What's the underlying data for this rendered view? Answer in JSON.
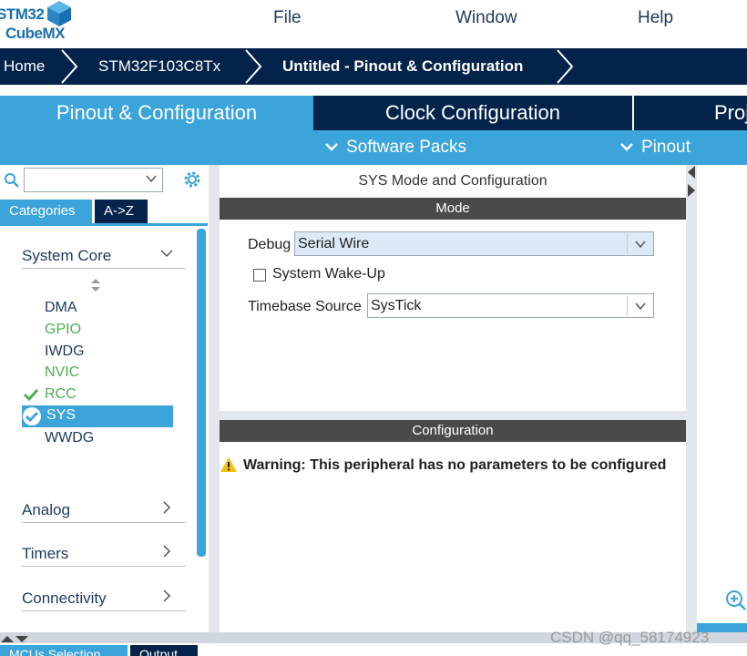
{
  "app": {
    "logo_line1": "STM32",
    "logo_line2": "CubeMX",
    "menu": [
      "File",
      "Window",
      "Help"
    ]
  },
  "breadcrumb": [
    "Home",
    "STM32F103C8Tx",
    "Untitled - Pinout & Configuration"
  ],
  "tabs": {
    "pinout_config": "Pinout & Configuration",
    "clock_config": "Clock Configuration",
    "project_partial": "Proj"
  },
  "subbar": {
    "software_packs": "Software Packs",
    "pinout": "Pinout"
  },
  "left": {
    "search_placeholder": "",
    "category_tabs": [
      "Categories",
      "A->Z"
    ],
    "groups": {
      "system_core": "System Core",
      "analog": "Analog",
      "timers": "Timers",
      "connectivity": "Connectivity"
    },
    "peripherals": [
      {
        "name": "DMA",
        "status": "normal"
      },
      {
        "name": "GPIO",
        "status": "green"
      },
      {
        "name": "IWDG",
        "status": "normal"
      },
      {
        "name": "NVIC",
        "status": "green"
      },
      {
        "name": "RCC",
        "status": "configured"
      },
      {
        "name": "SYS",
        "status": "selected"
      },
      {
        "name": "WWDG",
        "status": "normal"
      }
    ]
  },
  "mode_panel": {
    "title": "SYS Mode and Configuration",
    "mode_header": "Mode",
    "debug_label": "Debug",
    "debug_value": "Serial Wire",
    "wakeup_label": "System Wake-Up",
    "timebase_label": "Timebase Source",
    "timebase_value": "SysTick",
    "config_header": "Configuration",
    "warning": "Warning: This peripheral has no parameters to be configured"
  },
  "bottom": {
    "tab1": "MCUs Selection",
    "tab2": "Output"
  },
  "watermark": "CSDN @qq_58174923",
  "colors": {
    "navy": "#03234b",
    "accent": "#3ba4da",
    "green": "#4caf50",
    "warning": "#f4c20d"
  }
}
